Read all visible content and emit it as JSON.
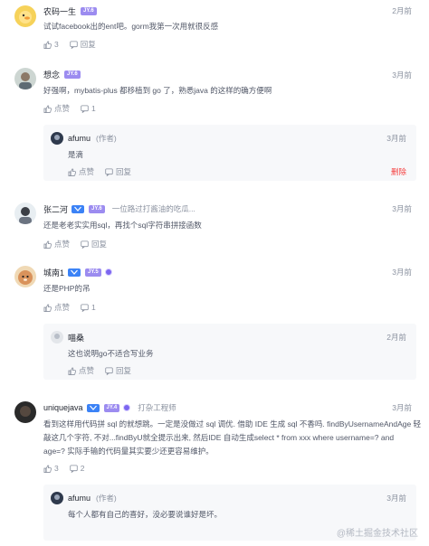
{
  "comments": [
    {
      "name": "农码一生",
      "level": "JY.6",
      "time": "2月前",
      "text": "试试facebook出的ent吧。gorm我第一次用就很反感",
      "likes": "3",
      "reply_label": "回复"
    },
    {
      "name": "想念",
      "level": "JY.6",
      "time": "3月前",
      "text": "好强啊，mybatis-plus 都移植到 go 了，熟悉java 的这样的确方便啊",
      "likes": "点赞",
      "replies": "1",
      "reply": {
        "name": "afumu",
        "author_tag": "(作者)",
        "time": "3月前",
        "text": "是滴",
        "likes": "点赞",
        "reply_label": "回复",
        "delete_label": "删除"
      }
    },
    {
      "name": "张二河",
      "level": "JY.6",
      "job": "一位路过打酱油的吃瓜...",
      "time": "3月前",
      "text": "还是老老实实用sql，再找个sql字符串拼接函数",
      "likes": "点赞",
      "reply_label": "回复"
    },
    {
      "name": "城南1",
      "level": "JY.5",
      "time": "3月前",
      "text": "还是PHP的吊",
      "likes": "点赞",
      "replies": "1",
      "reply": {
        "name": "喵桑",
        "time": "2月前",
        "text": "这也说明go不适合写业务",
        "likes": "点赞",
        "reply_label": "回复"
      }
    },
    {
      "name": "uniquejava",
      "level": "JY.4",
      "job": "打杂工程师",
      "time": "3月前",
      "text_lines": [
        "看到这样用代码拼 sql 的就想跳。一定是没做过 sql 调优. 借助 IDE 生成 sql 不香吗. findByUsernameAndAge 轻",
        "敲这几个字符, 不对...findByU就全提示出来, 然后IDE 自动生成select * from xxx where username=? and",
        "age=? 实际手输的代码量其实要少还更容易维护。"
      ],
      "likes": "3",
      "replies": "2",
      "reply": {
        "name": "afumu",
        "author_tag": "(作者)",
        "time": "3月前",
        "text": "每个人都有自己的喜好，没必要说谁好是坏。"
      }
    }
  ],
  "watermark": "@稀土掘金技术社区",
  "colors": {
    "level_badge": "#9c8cf0",
    "blue_badge": "#3b82f6",
    "delete": "#f53f3f",
    "muted": "#8a919f"
  }
}
